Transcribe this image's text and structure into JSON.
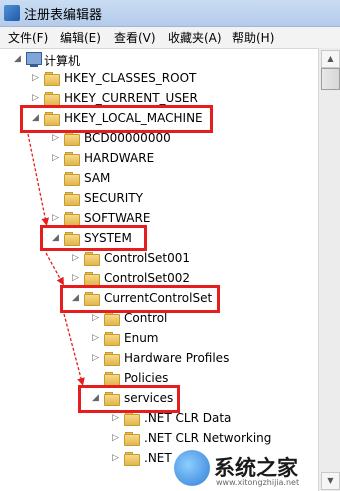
{
  "window": {
    "title": "注册表编辑器"
  },
  "menu": [
    "文件(F)",
    "编辑(E)",
    "查看(V)",
    "收藏夹(A)",
    "帮助(H)"
  ],
  "tree": {
    "root": "计算机",
    "nodes": [
      {
        "label": "HKEY_CLASSES_ROOT",
        "expanded": false
      },
      {
        "label": "HKEY_CURRENT_USER",
        "expanded": false
      },
      {
        "label": "HKEY_LOCAL_MACHINE",
        "expanded": true,
        "highlighted": true
      },
      {
        "label": "BCD00000000",
        "expanded": false
      },
      {
        "label": "HARDWARE",
        "expanded": false
      },
      {
        "label": "SAM",
        "expanded": false
      },
      {
        "label": "SECURITY",
        "expanded": false
      },
      {
        "label": "SOFTWARE",
        "expanded": false
      },
      {
        "label": "SYSTEM",
        "expanded": true,
        "highlighted": true
      },
      {
        "label": "ControlSet001",
        "expanded": false
      },
      {
        "label": "ControlSet002",
        "expanded": false
      },
      {
        "label": "CurrentControlSet",
        "expanded": true,
        "highlighted": true
      },
      {
        "label": "Control",
        "expanded": false
      },
      {
        "label": "Enum",
        "expanded": false
      },
      {
        "label": "Hardware Profiles",
        "expanded": false
      },
      {
        "label": "Policies",
        "expanded": false
      },
      {
        "label": "services",
        "expanded": true,
        "highlighted": true
      },
      {
        "label": ".NET CLR Data",
        "expanded": false
      },
      {
        "label": ".NET CLR Networking",
        "expanded": false
      },
      {
        "label": ".NET",
        "expanded": false
      }
    ]
  },
  "watermark": {
    "text": "系统之家",
    "sub": "www.xitongzhijia.net"
  },
  "colors": {
    "highlight": "#e51d1d",
    "folder": "#e9c467"
  }
}
